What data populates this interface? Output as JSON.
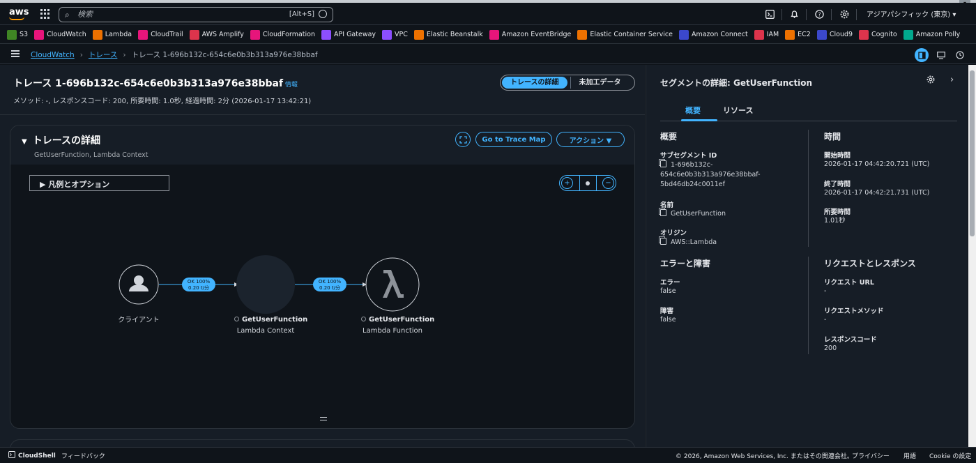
{
  "topnav": {
    "logo": "aws",
    "search_placeholder": "検索",
    "search_hint": "[Alt+S]",
    "region": "アジアパシフィック (東京) ▾",
    "icons": [
      "cloudshell-icon",
      "bell-icon",
      "help-icon",
      "gear-icon"
    ]
  },
  "favorites": [
    {
      "label": "S3",
      "color": "#3f8624"
    },
    {
      "label": "CloudWatch",
      "color": "#e7157b"
    },
    {
      "label": "Lambda",
      "color": "#ed7100"
    },
    {
      "label": "CloudTrail",
      "color": "#e7157b"
    },
    {
      "label": "AWS Amplify",
      "color": "#dd344c"
    },
    {
      "label": "CloudFormation",
      "color": "#e7157b"
    },
    {
      "label": "API Gateway",
      "color": "#8c4fff"
    },
    {
      "label": "VPC",
      "color": "#8c4fff"
    },
    {
      "label": "Elastic Beanstalk",
      "color": "#ed7100"
    },
    {
      "label": "Amazon EventBridge",
      "color": "#e7157b"
    },
    {
      "label": "Elastic Container Service",
      "color": "#ed7100"
    },
    {
      "label": "Amazon Connect",
      "color": "#3b48cc"
    },
    {
      "label": "IAM",
      "color": "#dd344c"
    },
    {
      "label": "EC2",
      "color": "#ed7100"
    },
    {
      "label": "Cloud9",
      "color": "#3b48cc"
    },
    {
      "label": "Cognito",
      "color": "#dd344c"
    },
    {
      "label": "Amazon Polly",
      "color": "#01a88d"
    }
  ],
  "breadcrumb": {
    "item1": "CloudWatch",
    "item2": "トレース",
    "current": "トレース 1-696b132c-654c6e0b3b313a976e38bbaf"
  },
  "page": {
    "title": "トレース 1-696b132c-654c6e0b3b313a976e38bbaf",
    "info": "情報",
    "subtitle": "メソッド: -, レスポンスコード: 200, 所要時間: 1.0秒, 経過時間: 2分 (2026-01-17 13:42:21)",
    "seg_on": "トレースの詳細",
    "seg_off": "未加工データ"
  },
  "card": {
    "title": "トレースの詳細",
    "subtitle": "GetUserFunction, Lambda Context",
    "go_map": "Go to Trace Map",
    "actions": "アクション ▼",
    "legend": "▶ 凡例とオプション"
  },
  "graph": {
    "client_label": "クライアント",
    "edge1_l1": "OK 100%",
    "edge1_l2": "0.20 t/分",
    "edge2_l1": "OK 100%",
    "edge2_l2": "0.20 t/分",
    "node2_name": "GetUserFunction",
    "node2_type": "Lambda Context",
    "node3_name": "GetUserFunction",
    "node3_type": "Lambda Function"
  },
  "panel": {
    "title": "セグメントの詳細: GetUserFunction",
    "tab1": "概要",
    "tab2": "リソース",
    "overview_h": "概要",
    "time_h": "時間",
    "subseg_label": "サブセグメント ID",
    "subseg_l1": "1-696b132c-",
    "subseg_l2": "654c6e0b3b313a976e38bbaf-",
    "subseg_l3": "5bd46db24c0011ef",
    "name_label": "名前",
    "name_value": "GetUserFunction",
    "origin_label": "オリジン",
    "origin_value": "AWS::Lambda",
    "start_label": "開始時間",
    "start_value": "2026-01-17 04:42:20.721 (UTC)",
    "end_label": "終了時間",
    "end_value": "2026-01-17 04:42:21.731 (UTC)",
    "dur_label": "所要時間",
    "dur_value": "1.01秒",
    "err_h": "エラーと障害",
    "err_label": "エラー",
    "err_value": "false",
    "fault_label": "障害",
    "fault_value": "false",
    "req_h": "リクエストとレスポンス",
    "url_label": "リクエスト URL",
    "url_value": "-",
    "method_label": "リクエストメソッド",
    "method_value": "-",
    "code_label": "レスポンスコード",
    "code_value": "200"
  },
  "footer": {
    "cloudshell": "CloudShell",
    "feedback": "フィードバック",
    "copyright": "© 2026, Amazon Web Services, Inc. またはその関連会社。",
    "privacy": "プライバシー",
    "terms": "用語",
    "cookie": "Cookie の設定"
  },
  "colors": {
    "accent": "#42b4ff",
    "bg": "#0f141a",
    "panel": "#161d26"
  }
}
